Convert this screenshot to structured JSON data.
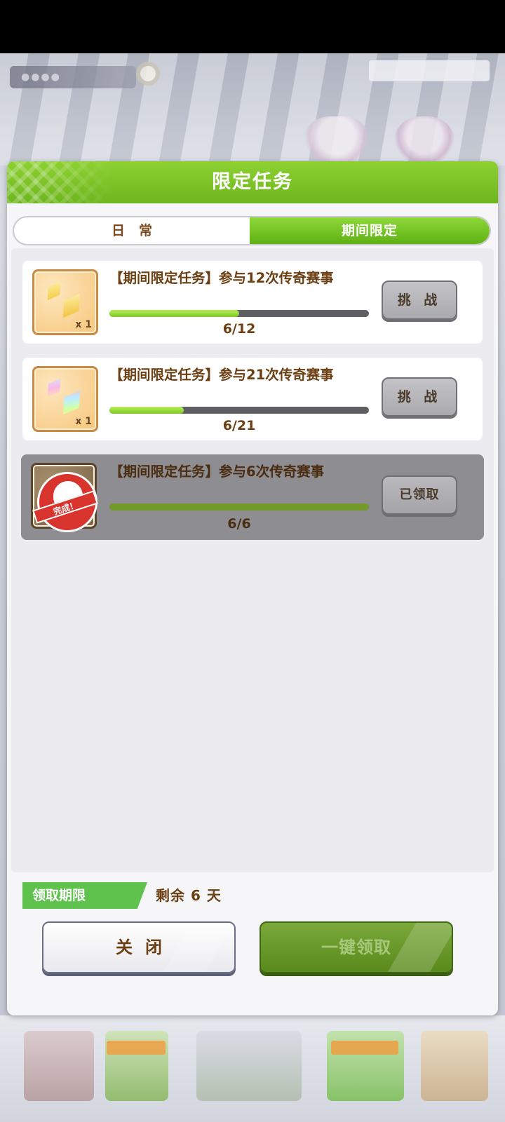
{
  "dialog": {
    "title": "限定任务"
  },
  "tabs": [
    {
      "label": "日常",
      "active": false
    },
    {
      "label": "期间限定",
      "active": true
    }
  ],
  "missions": [
    {
      "title": "【期间限定任务】参与12次传奇赛事",
      "progress_text": "6/12",
      "progress": 0.5,
      "reward_qty": "x 1",
      "reward_icon": "yellow-crystal-icon",
      "button": "挑 战",
      "claimed": false
    },
    {
      "title": "【期间限定任务】参与21次传奇赛事",
      "progress_text": "6/21",
      "progress": 0.286,
      "reward_qty": "x 1",
      "reward_icon": "rainbow-crystal-icon",
      "button": "挑 战",
      "claimed": false
    },
    {
      "title": "【期间限定任务】参与6次传奇赛事",
      "progress_text": "6/6",
      "progress": 1.0,
      "stamp": "完成！",
      "button": "已领取",
      "claimed": true
    }
  ],
  "deadline": {
    "label": "领取期限",
    "value": "剩余 6 天"
  },
  "buttons": {
    "close": "关闭",
    "claim_all": "一键领取"
  },
  "colors": {
    "header_green": "#7cc227",
    "text_brown": "#6b3f12",
    "progress_green": "#9ddc3c"
  }
}
